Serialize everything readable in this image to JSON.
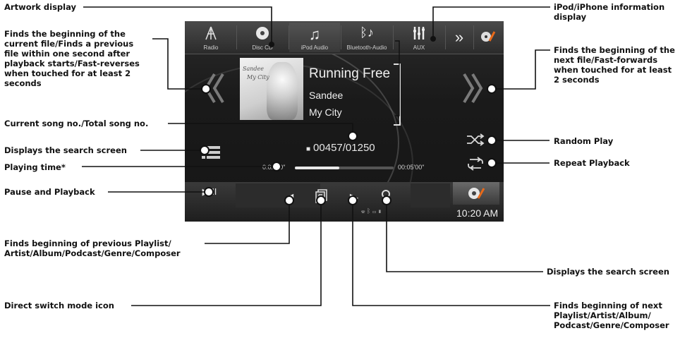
{
  "labels": {
    "artwork_display": "Artwork display",
    "finds_beginning_current": [
      "Finds the beginning of the",
      "current file/Finds a previous",
      "file within one second after",
      "playback starts/Fast-reverses",
      "when touched for at least 2",
      "seconds"
    ],
    "current_song_no": "Current song no./Total song no.",
    "displays_search_left": "Displays the search screen",
    "playing_time": "Playing time*",
    "pause_playback": "Pause and Playback",
    "finds_prev_playlist": [
      "Finds beginning of previous Playlist/",
      "Artist/Album/Podcast/Genre/Composer"
    ],
    "direct_switch": "Direct switch mode icon",
    "ipod_info": [
      "iPod/iPhone information",
      "display"
    ],
    "finds_beginning_next": [
      "Finds the beginning of the",
      "next file/Fast-forwards",
      "when touched for at least",
      "2 seconds"
    ],
    "random_play": "Random Play",
    "repeat_playback": "Repeat Playback",
    "displays_search_right": "Displays the search screen",
    "finds_next_playlist": [
      "Finds beginning of next",
      "Playlist/Artist/Album/",
      "Podcast/Genre/Composer"
    ]
  },
  "screen": {
    "sources": [
      {
        "label": "Radio",
        "icon": "radio-antenna-icon"
      },
      {
        "label": "Disc CD",
        "icon": "disc-icon"
      },
      {
        "label": "iPod Audio",
        "icon": "music-note-icon"
      },
      {
        "label": "Bluetooth-Audio",
        "icon": "bluetooth-music-icon"
      },
      {
        "label": "AUX",
        "icon": "aux-icon"
      }
    ],
    "more_icon": "chevron-double-right-icon",
    "setup_icon": "setup-wrench-icon",
    "song_title": "Running Free",
    "artist": "Sandee",
    "album": "My City",
    "album_art_text": [
      "Sandee",
      "My City"
    ],
    "track_counter": "00457/01250",
    "elapsed": "0:02'20\"",
    "total": "00:05'00\"",
    "progress": 0.45,
    "clock": "10:20 AM"
  },
  "colors": {
    "screen_bg": "#1c1c1c",
    "text": "#f0f0f0",
    "leader_line": "#111111"
  }
}
